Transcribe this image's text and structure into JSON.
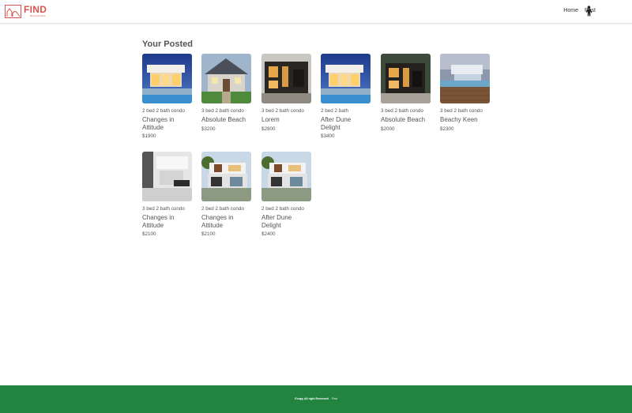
{
  "brand": {
    "name": "FIND",
    "tagline": "find your home",
    "color": "#d9534f"
  },
  "nav": {
    "home": "Home",
    "post": "Post",
    "user_icon": "user-silhouette-icon"
  },
  "page": {
    "heading": "Your Posted"
  },
  "listings": [
    {
      "subtitle": "2 bed 2 bath condo",
      "title": "Changes in Attitude",
      "price": "$1900",
      "image": "modern-villa-pool-photo"
    },
    {
      "subtitle": "3 bed 2 bath condo",
      "title": "Absolute Beach",
      "price": "$3200",
      "image": "craftsman-house-photo"
    },
    {
      "subtitle": "3 bed 2 bath condo",
      "title": "Lorem",
      "price": "$2800",
      "image": "dark-modern-house-photo"
    },
    {
      "subtitle": "2 bed 2 bath",
      "title": "After Dune Delight",
      "price": "$3400",
      "image": "modern-villa-pool-photo"
    },
    {
      "subtitle": "3 bed 2 bath condo",
      "title": "Absolute Beach",
      "price": "$2000",
      "image": "dark-modern-house-photo"
    },
    {
      "subtitle": "3 bed 2 bath condo",
      "title": "Beachy Keen",
      "price": "$2300",
      "image": "beach-house-deck-photo"
    },
    {
      "subtitle": "3 bed 2 bath condo",
      "title": "Changes in Attitude",
      "price": "$2100",
      "image": "white-interior-photo"
    },
    {
      "subtitle": "2 bed 2 bath condo",
      "title": "Changes in Attitude",
      "price": "$2100",
      "image": "modern-two-storey-house-photo"
    },
    {
      "subtitle": "2 bed 2 bath condo",
      "title": "After Dune Delight",
      "price": "$2400",
      "image": "modern-two-storey-house-photo"
    }
  ],
  "footer": {
    "copyright": "Ecopy All right Reversed.",
    "brand": "Find",
    "color": "#23843f"
  }
}
